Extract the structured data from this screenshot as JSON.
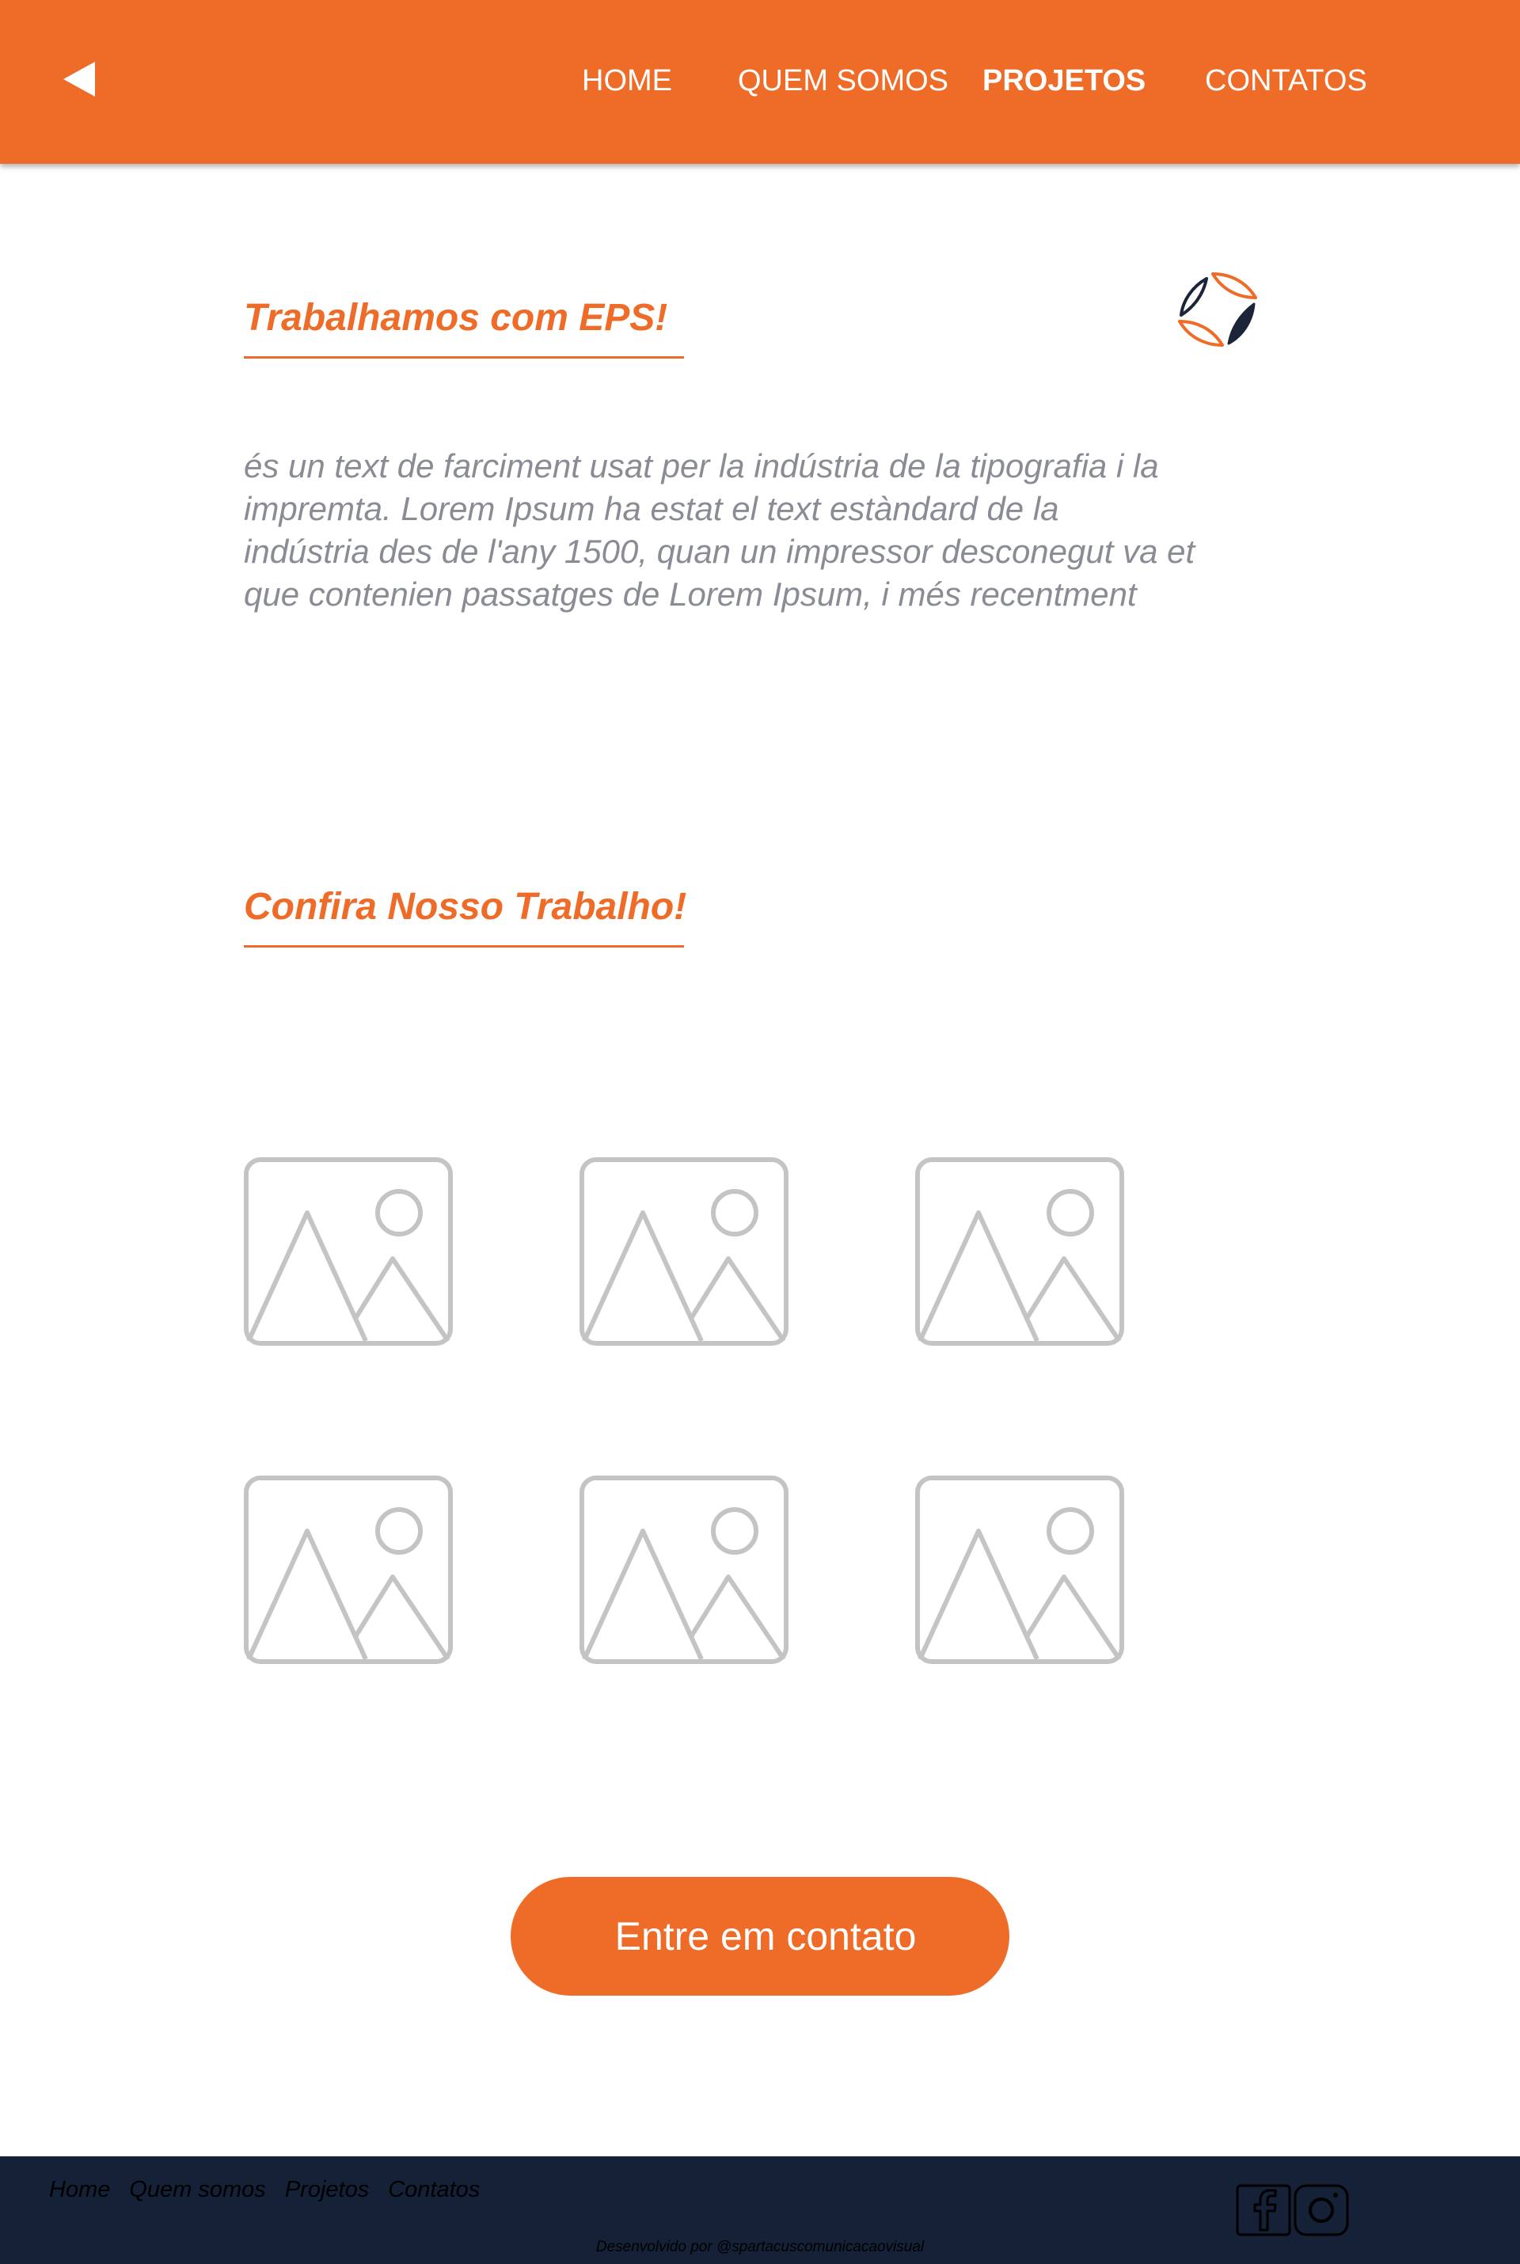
{
  "colors": {
    "accent": "#ef6b28",
    "footer_bg": "#142137",
    "body_text": "#8a8c95",
    "placeholder_stroke": "#c4c4c4",
    "logo_dark": "#1b2438"
  },
  "header": {
    "back_icon": "back-triangle-icon",
    "nav": [
      {
        "label": "HOME",
        "active": false
      },
      {
        "label": "QUEM SOMOS",
        "active": false
      },
      {
        "label": "PROJETOS",
        "active": true
      },
      {
        "label": "CONTATOS",
        "active": false
      }
    ]
  },
  "about": {
    "title": "Trabalhamos com EPS!",
    "logo_icon": "brand-logo-icon",
    "text": "és un text de farciment usat per la indústria de la tipografia i la\nimpremta. Lorem Ipsum ha estat el text estàndard de la\nindústria des de l'any 1500, quan un impressor desconegut va et\nque contenien passatges de Lorem Ipsum, i més recentment"
  },
  "gallery": {
    "title": "Confira Nosso Trabalho!",
    "item_icon": "image-placeholder-icon",
    "items_count_rows": 2,
    "items_per_row": 3
  },
  "cta": {
    "label": "Entre em contato"
  },
  "footer": {
    "links": [
      "Home",
      "Quem somos",
      "Projetos",
      "Contatos"
    ],
    "social_icons": [
      "facebook-icon",
      "instagram-icon"
    ],
    "credit": "Desenvolvido por @spartacuscomunicacaovisual"
  }
}
